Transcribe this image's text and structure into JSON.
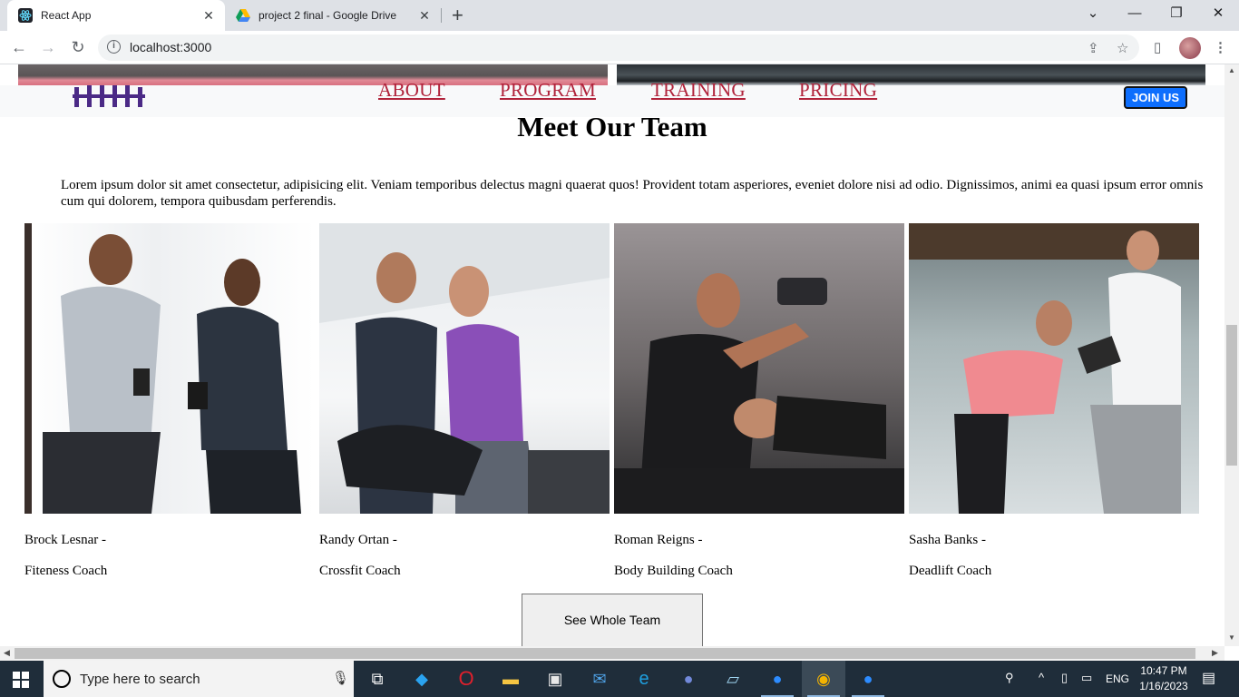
{
  "browser": {
    "tabs": [
      {
        "title": "React App",
        "active": true
      },
      {
        "title": "project 2 final - Google Drive",
        "active": false
      }
    ],
    "url": "localhost:3000"
  },
  "site": {
    "nav": {
      "links": [
        "ABOUT",
        "PROGRAM",
        "TRAINING",
        "PRICING"
      ],
      "join_label": "JOIN US"
    },
    "team": {
      "title": "Meet Our Team",
      "intro": "Lorem ipsum dolor sit amet consectetur, adipisicing elit. Veniam temporibus delectus magni quaerat quos! Provident totam asperiores, eveniet dolore nisi ad odio. Dignissimos, animi ea quasi ipsum error omnis cum qui dolorem, tempora quibusdam perferendis.",
      "members": [
        {
          "name": "Brock Lesnar -",
          "role": "Fiteness Coach"
        },
        {
          "name": "Randy Ortan -",
          "role": "Crossfit Coach"
        },
        {
          "name": "Roman Reigns -",
          "role": "Body Building Coach"
        },
        {
          "name": "Sasha Banks -",
          "role": "Deadlift Coach"
        }
      ],
      "see_all_label": "See Whole Team"
    }
  },
  "taskbar": {
    "search_placeholder": "Type here to search",
    "language": "ENG",
    "time": "10:47 PM",
    "date": "1/16/2023",
    "apps": [
      "task-view",
      "vscode",
      "opera",
      "file-explorer",
      "microsoft-store",
      "mail",
      "edge",
      "discord",
      "notepad",
      "zoom",
      "chrome",
      "zoom"
    ]
  },
  "colors": {
    "nav_link": "#b0223a",
    "join_button": "#0d6efd",
    "logo": "#4b2a86",
    "taskbar": "#1f2d3a"
  }
}
